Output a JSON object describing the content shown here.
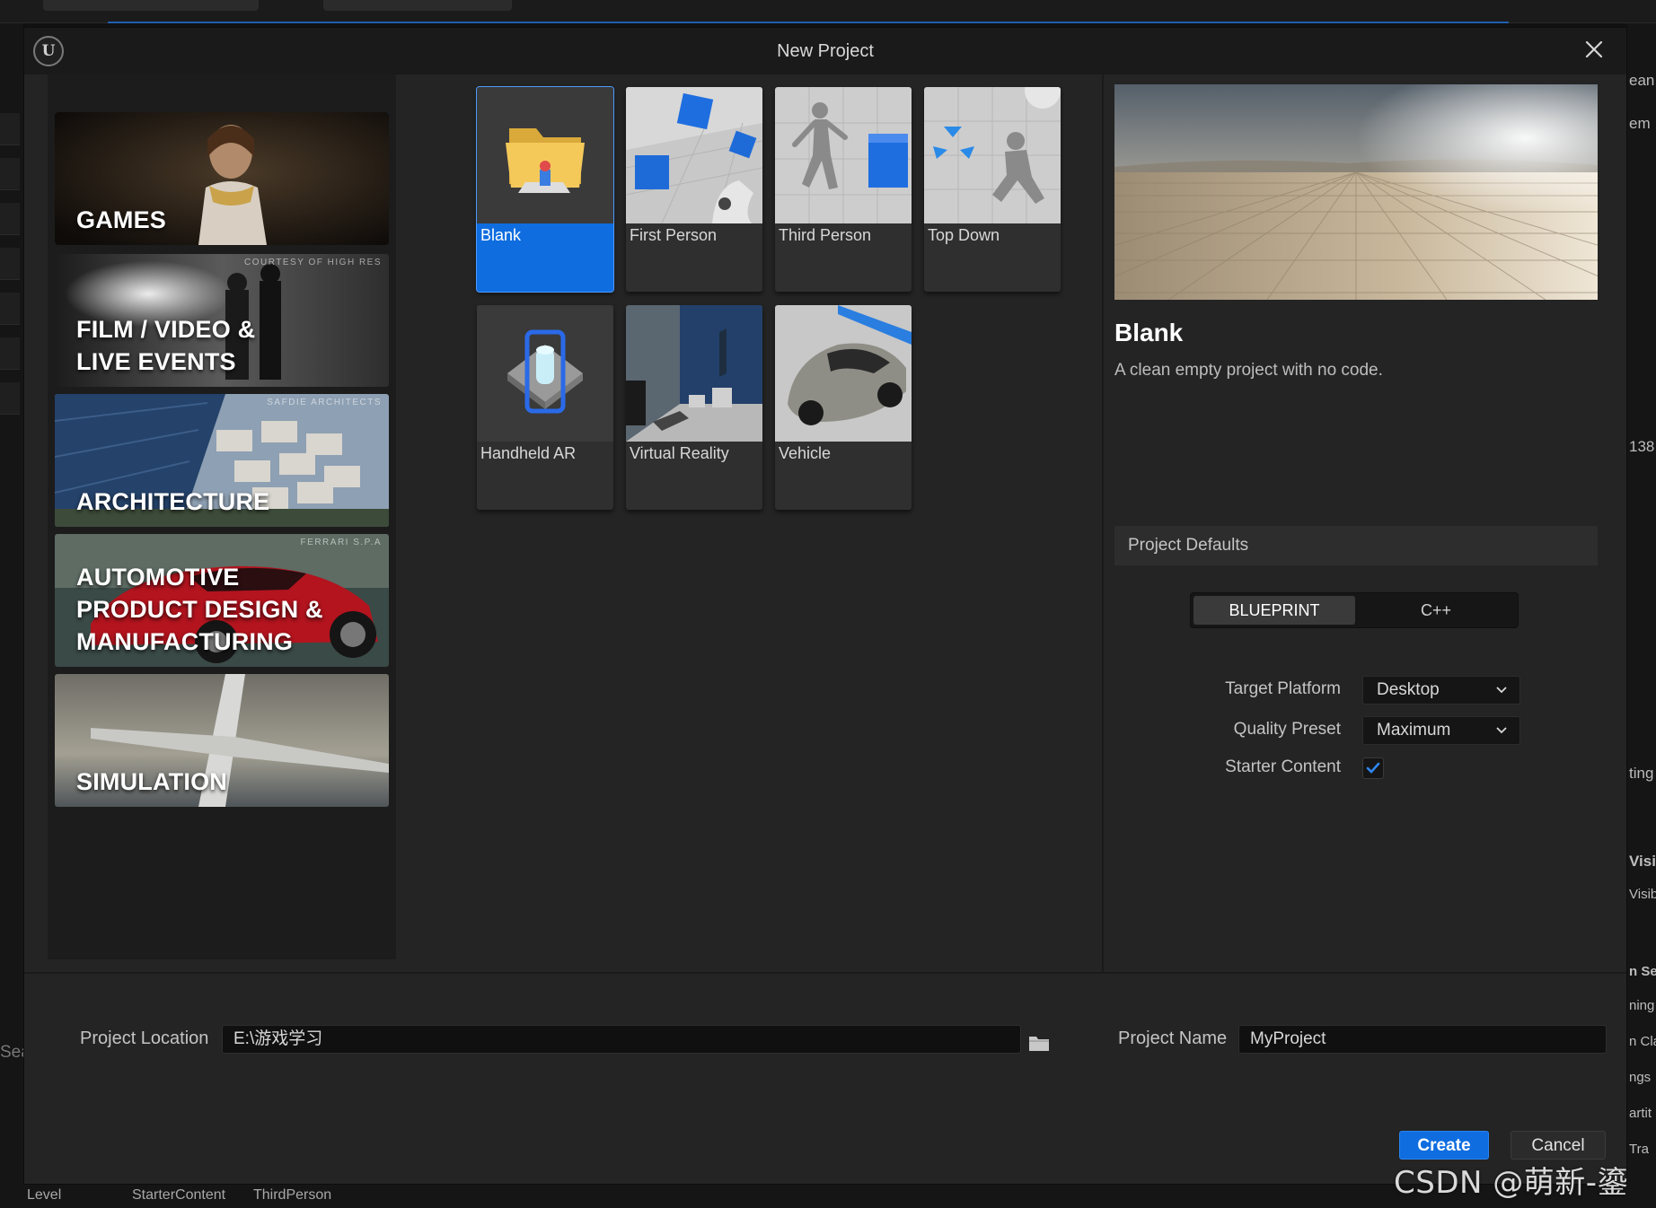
{
  "dialog": {
    "title": "New Project"
  },
  "categories": [
    {
      "label": "GAMES",
      "credit": "",
      "selected": true
    },
    {
      "label": "FILM / VIDEO &\nLIVE EVENTS",
      "credit": "COURTESY OF HIGH RES"
    },
    {
      "label": "ARCHITECTURE",
      "credit": "SAFDIE ARCHITECTS"
    },
    {
      "label": "AUTOMOTIVE\nPRODUCT DESIGN &\nMANUFACTURING",
      "credit": "FERRARI S.P.A"
    },
    {
      "label": "SIMULATION",
      "credit": ""
    }
  ],
  "templates": [
    {
      "label": "Blank",
      "icon": "folder-icon",
      "selected": true
    },
    {
      "label": "First Person",
      "icon": "first-person-thumbnail"
    },
    {
      "label": "Third Person",
      "icon": "third-person-thumbnail"
    },
    {
      "label": "Top Down",
      "icon": "top-down-thumbnail"
    },
    {
      "label": "Handheld AR",
      "icon": "phone-ar-icon"
    },
    {
      "label": "Virtual Reality",
      "icon": "vr-thumbnail"
    },
    {
      "label": "Vehicle",
      "icon": "car-thumbnail"
    }
  ],
  "details": {
    "name": "Blank",
    "description": "A clean empty project with no code."
  },
  "defaults": {
    "header": "Project Defaults",
    "language_options": [
      "BLUEPRINT",
      "C++"
    ],
    "language_selected": "BLUEPRINT",
    "target_platform_label": "Target Platform",
    "target_platform_value": "Desktop",
    "quality_preset_label": "Quality Preset",
    "quality_preset_value": "Maximum",
    "starter_content_label": "Starter Content",
    "starter_content_checked": true
  },
  "footer": {
    "location_label": "Project Location",
    "location_value": "E:\\游戏学习",
    "name_label": "Project Name",
    "name_value": "MyProject",
    "create_label": "Create",
    "cancel_label": "Cancel"
  },
  "background": {
    "bottom_tabs": [
      "Level",
      "StarterContent",
      "ThirdPerson"
    ],
    "right_fragments": [
      "ean",
      "em",
      "138",
      "ting",
      "Visi",
      "Visib",
      "n Se",
      "ning",
      "n Cla",
      "ngs",
      "artit",
      "Tra"
    ],
    "left_fragment": "Sea"
  },
  "watermark": "CSDN @萌新-鎏锋",
  "colors": {
    "accent": "#0f6de0",
    "dialog_bg": "#242424",
    "panel_bg": "#1c1c1c"
  }
}
